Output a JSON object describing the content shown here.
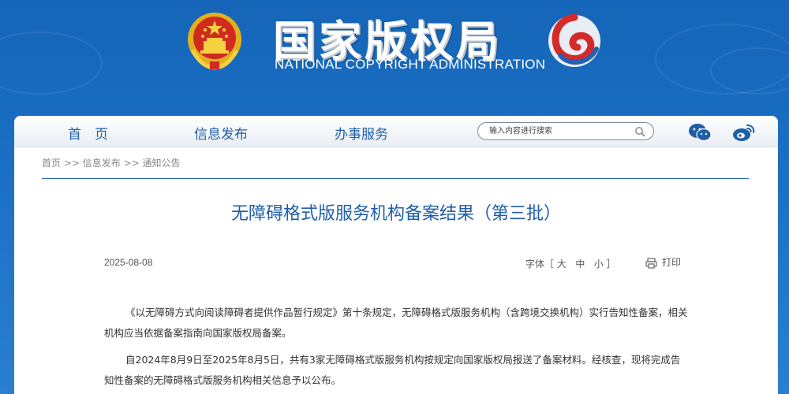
{
  "header": {
    "title_cn": "国家版权局",
    "title_en": "NATIONAL COPYRIGHT ADMINISTRATION"
  },
  "nav": {
    "items": [
      {
        "label": "首　页"
      },
      {
        "label": "信息发布"
      },
      {
        "label": "办事服务"
      }
    ],
    "search_placeholder": "输入内容进行搜索"
  },
  "breadcrumb": {
    "home": "首页",
    "sep1": " >> ",
    "section": "信息发布",
    "sep2": " >> ",
    "current": "通知公告"
  },
  "article": {
    "title": "无障碍格式版服务机构备案结果（第三批）",
    "date": "2025-08-08",
    "font_size_label": "字体［",
    "font_large": "大",
    "font_medium": "中",
    "font_small": "小",
    "font_size_close": "］",
    "print_label": "打印",
    "paragraphs": [
      "《以无障碍方式向阅读障碍者提供作品暂行规定》第十条规定，无障碍格式版服务机构（含跨境交换机构）实行告知性备案，相关机构应当依据备案指南向国家版权局备案。",
      "自2024年8月9日至2025年8月5日，共有3家无障碍格式版服务机构按规定向国家版权局报送了备案材料。经核查，现将完成告知性备案的无障碍格式版服务机构相关信息予以公布。"
    ]
  },
  "colors": {
    "header_bg": "#1a6fc4",
    "nav_text": "#1f5fa8",
    "title_text": "#1f5fa8",
    "divider": "#2b6cb8"
  }
}
